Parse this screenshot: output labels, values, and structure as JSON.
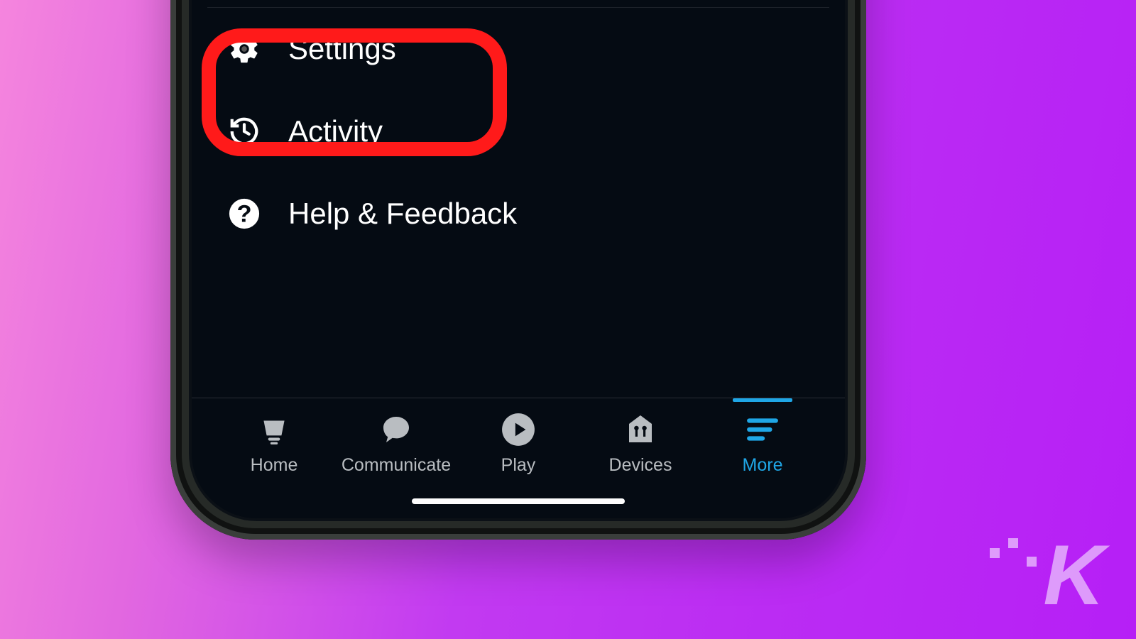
{
  "menu": {
    "items": [
      {
        "label": "Settings",
        "icon": "gear-icon",
        "highlighted": true
      },
      {
        "label": "Activity",
        "icon": "history-icon",
        "highlighted": false
      },
      {
        "label": "Help & Feedback",
        "icon": "help-icon",
        "highlighted": false
      }
    ]
  },
  "tabbar": {
    "items": [
      {
        "label": "Home",
        "icon": "home-icon",
        "active": false
      },
      {
        "label": "Communicate",
        "icon": "chat-icon",
        "active": false
      },
      {
        "label": "Play",
        "icon": "play-icon",
        "active": false
      },
      {
        "label": "Devices",
        "icon": "devices-icon",
        "active": false
      },
      {
        "label": "More",
        "icon": "more-icon",
        "active": true
      }
    ]
  },
  "colors": {
    "accent": "#1fa6e6",
    "highlight": "#ff1a1a",
    "screen_bg": "#050b13",
    "text": "#ffffff",
    "tab_inactive": "#b9bdc1"
  },
  "watermark": {
    "letter": "K"
  }
}
